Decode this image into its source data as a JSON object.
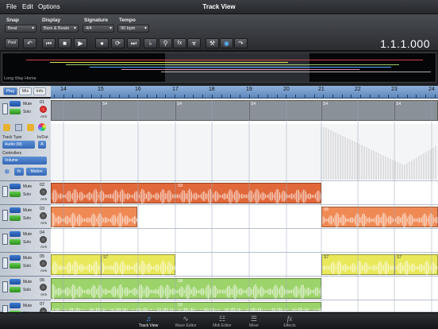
{
  "menu": {
    "file": "File",
    "edit": "Edit",
    "options": "Options",
    "title": "Track View"
  },
  "toolbar": {
    "snap_label": "Snap",
    "snap_value": "Beat",
    "display_label": "Display",
    "display_value": "Bars & Beats",
    "signature_label": "Signature",
    "signature_value": "4/4",
    "tempo_label": "Tempo",
    "tempo_value": "90 bpm",
    "pool_label": "Pool",
    "counter": "1.1.1.000"
  },
  "overview": {
    "song_name": "Long Way Home"
  },
  "tabs": {
    "play": "Play",
    "mix": "Mix",
    "info": "Info"
  },
  "ruler": {
    "bars": [
      "14",
      "15",
      "16",
      "17",
      "18",
      "19",
      "20",
      "21",
      "22",
      "23",
      "24"
    ]
  },
  "track1": {
    "number": "01",
    "mute": "Mute",
    "solo": "Solo",
    "arm": "Arm",
    "inout": "In/Out",
    "track_type_label": "Track Type",
    "track_type_value": "Audio (M)",
    "a_button": "A",
    "controllers_label": "Controllers",
    "controller_value": "Volume",
    "fx": "fx",
    "motion": "Motion",
    "clips": [
      "S4",
      "S4",
      "S4",
      "S4",
      "S4",
      "S4"
    ]
  },
  "tracks": [
    {
      "number": "02",
      "mute": "Mute",
      "solo": "Solo",
      "arm": "Arm",
      "clip": "S9"
    },
    {
      "number": "03",
      "mute": "Mute",
      "solo": "Solo",
      "arm": "Arm",
      "clip": "S5"
    },
    {
      "number": "04",
      "mute": "Mute",
      "solo": "Solo",
      "arm": "Arm"
    },
    {
      "number": "05",
      "mute": "Mute",
      "solo": "Solo",
      "arm": "Arm",
      "clips": [
        "S7",
        "S7",
        "S7"
      ]
    },
    {
      "number": "06",
      "mute": "Mute",
      "solo": "Solo",
      "arm": "Arm",
      "clip": "S8"
    },
    {
      "number": "07",
      "mute": "Mute",
      "solo": "Solo",
      "arm": "Arm",
      "clip": "S3"
    }
  ],
  "bottom": {
    "track_view": "Track View",
    "wave_editor": "Wave Editor",
    "midi_editor": "Midi Editor",
    "mixer": "Mixer",
    "effects": "Effects"
  },
  "icons": {
    "track_view": "music-note-icon",
    "wave_editor": "waveform-icon",
    "midi_editor": "piano-keys-icon",
    "mixer": "mixer-sliders-icon",
    "effects": "fx-icon"
  },
  "colors": {
    "accent": "#3a7bd5",
    "clip_gray": "#8a9199",
    "clip_orange": "#e0683a",
    "clip_salmon": "#f08a55",
    "clip_yellow": "#e8e85a",
    "clip_green": "#9cd36a"
  }
}
